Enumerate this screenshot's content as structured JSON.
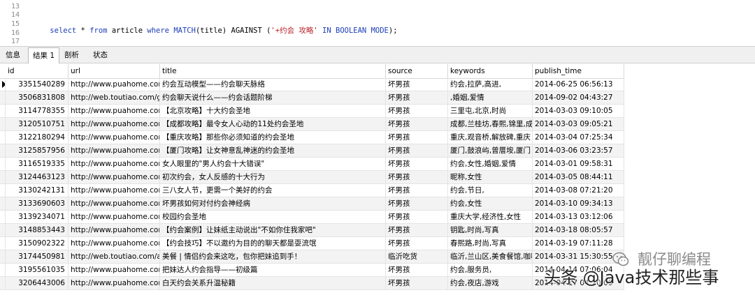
{
  "editor": {
    "line_numbers": [
      "13",
      "14",
      "15",
      "16",
      "17"
    ],
    "query_tokens": [
      {
        "text": "select",
        "kind": "kw"
      },
      {
        "text": " * ",
        "kind": "tx"
      },
      {
        "text": "from",
        "kind": "kw"
      },
      {
        "text": " article ",
        "kind": "tx"
      },
      {
        "text": "where",
        "kind": "kw"
      },
      {
        "text": " MATCH",
        "kind": "kw"
      },
      {
        "text": "(title) AGAINST (",
        "kind": "tx"
      },
      {
        "text": "'+约会 攻略'",
        "kind": "str"
      },
      {
        "text": " IN BOOLEAN MODE",
        "kind": "kw"
      },
      {
        "text": ");",
        "kind": "tx"
      }
    ]
  },
  "tabs": [
    {
      "label": "信息",
      "active": false
    },
    {
      "label": "结果 1",
      "active": true
    },
    {
      "label": "剖析",
      "active": false
    },
    {
      "label": "状态",
      "active": false
    }
  ],
  "columns": [
    "id",
    "url",
    "title",
    "source",
    "keywords",
    "publish_time"
  ],
  "rows": [
    [
      "3351540289",
      "http://www.puahome.com",
      "约会互动模型——约会聊天脉络",
      "坏男孩",
      "约会,拉萨,高进,",
      "2014-06-25 06:56:13"
    ],
    [
      "3506831808",
      "http://web.toutiao.com/group/",
      "约会聊天说什么——约会话题阶梯",
      "坏男孩",
      ",婚姻,爱情",
      "2014-09-02 04:43:27"
    ],
    [
      "3114778355",
      "http://www.puahome.com",
      "【北京攻略】十大约会圣地",
      "坏男孩",
      "三里屯,北京,时尚",
      "2014-03-03 09:10:05"
    ],
    [
      "3120510751",
      "http://www.puahome.com",
      "【成都攻略】最令女人心动的11处约会圣地",
      "坏男孩",
      "成都,兰桂坊,春熙,锦里,成都",
      "2014-03-03 09:05:21"
    ],
    [
      "3122180294",
      "http://www.puahome.com",
      "【重庆攻略】那些你必须知道的约会圣地",
      "坏男孩",
      "重庆,观音桥,解放碑,重庆",
      "2014-03-04 07:25:34"
    ],
    [
      "3125857956",
      "http://www.puahome.com",
      "【厦门攻略】让女神意乱神迷的约会圣地",
      "坏男孩",
      "厦门,鼓浪屿,曾厝垵,厦门",
      "2014-03-06 03:23:57"
    ],
    [
      "3116519335",
      "http://www.puahome.com",
      "女人眼里的\"男人约会十大错误\"",
      "坏男孩",
      "约会,女性,婚姻,爱情",
      "2014-03-01 09:58:31"
    ],
    [
      "3124463123",
      "http://www.puahome.com",
      "初次约会，女人反感的十大行为",
      "坏男孩",
      "昵称,女性",
      "2014-03-05 08:44:11"
    ],
    [
      "3130242131",
      "http://www.puahome.com",
      "三八女人节，更需一个美好的约会",
      "坏男孩",
      "约会,节日,",
      "2014-03-08 07:21:20"
    ],
    [
      "3133690603",
      "http://www.puahome.com",
      "坏男孩如何对付约会神经病",
      "坏男孩",
      "约会,女性",
      "2014-03-10 09:34:13"
    ],
    [
      "3139234071",
      "http://www.puahome.com",
      "校园约会圣地",
      "坏男孩",
      "重庆大学,经济性,女性",
      "2014-03-13 03:12:06"
    ],
    [
      "3148853443",
      "http://www.puahome.com",
      "【约会案例】让妹纸主动说出\"不如你住我家吧\"",
      "坏男孩",
      "钥匙,时尚,写真",
      "2014-03-18 08:05:57"
    ],
    [
      "3150902322",
      "http://www.puahome.com",
      "【约会技巧】不以邀约为目的的聊天都是耍流氓",
      "坏男孩",
      "春熙路,时尚,写真",
      "2014-03-19 07:11:28"
    ],
    [
      "3174450981",
      "http://web.toutiao.com/a/",
      "美餐 | 情侣约会来这吃，包你把妹追到手！",
      "临沂吃货",
      "临沂,兰山区,美食餐馆,咖啡",
      "2014-03-31 15:30:55"
    ],
    [
      "3195561035",
      "http://www.puahome.com",
      "把妹达人约会指导——初级篇",
      "坏男孩",
      "约会,服务员,",
      "2014-04-14 07:06:04"
    ],
    [
      "3206443006",
      "http://www.puahome.com",
      "白天约会关系升温秘籍",
      "坏男孩",
      "约会,夜店,游戏",
      "2014-04-17 04:20:09"
    ]
  ],
  "watermark": {
    "brand": "靓仔聊编程",
    "overlay": "头条 @Java技术那些事"
  }
}
